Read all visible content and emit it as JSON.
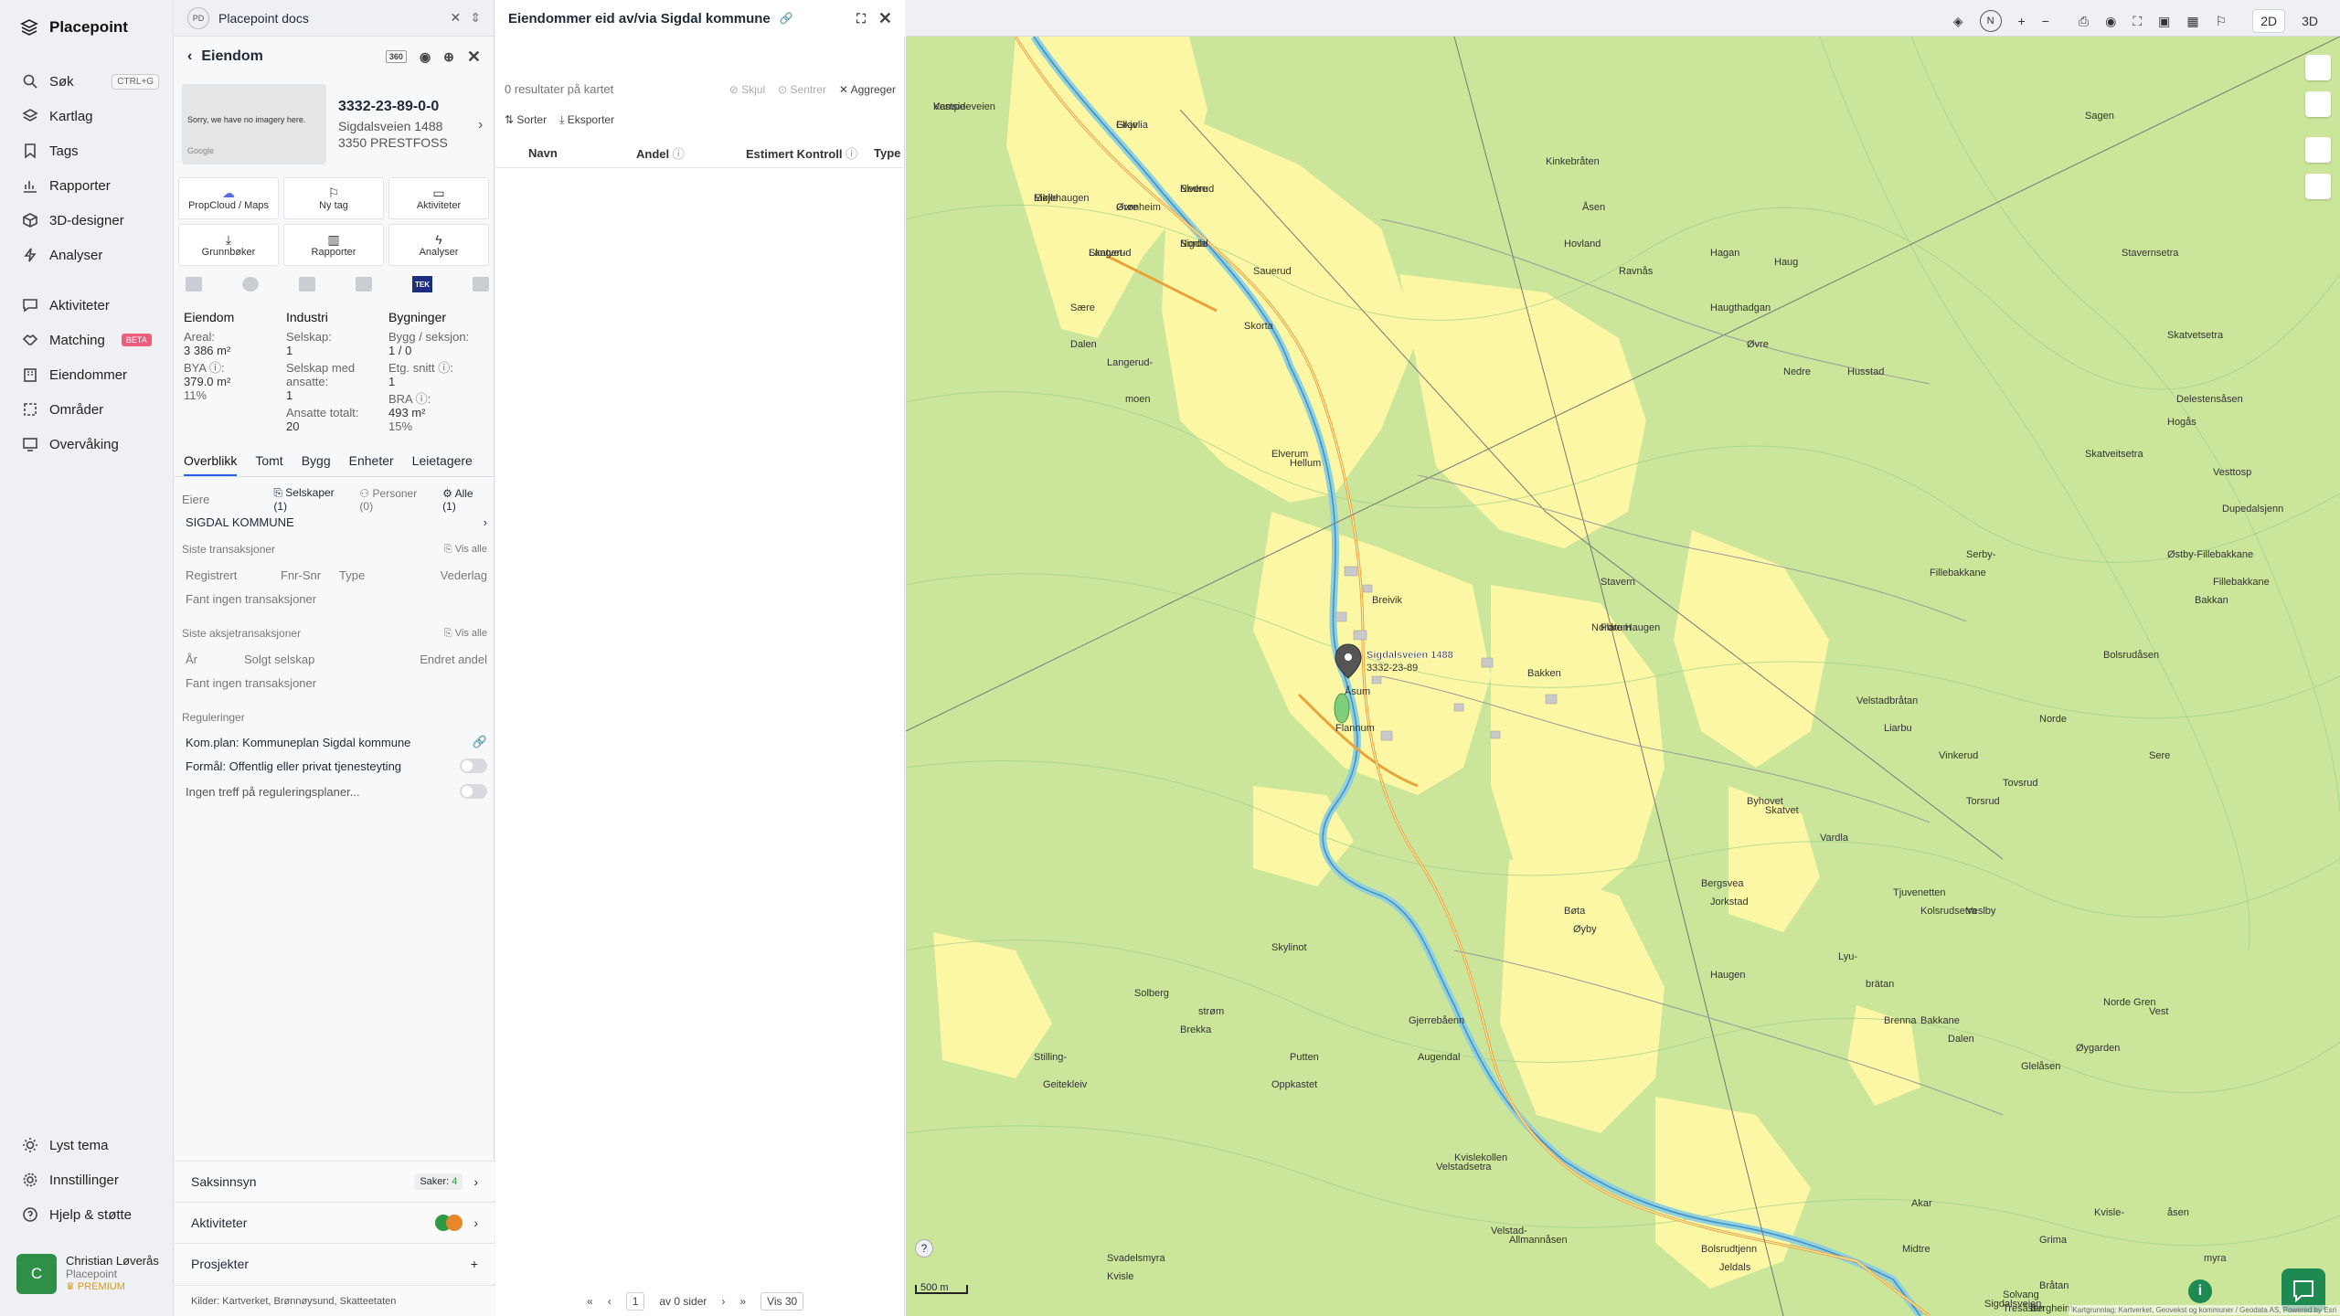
{
  "app": {
    "name": "Placepoint"
  },
  "sidebar": {
    "search": {
      "label": "Søk",
      "shortcut": "CTRL+G"
    },
    "items": [
      {
        "label": "Kartlag"
      },
      {
        "label": "Tags"
      },
      {
        "label": "Rapporter"
      },
      {
        "label": "3D-designer"
      },
      {
        "label": "Analyser"
      },
      {
        "label": "Aktiviteter"
      },
      {
        "label": "Matching",
        "badge": "BETA"
      },
      {
        "label": "Eiendommer"
      },
      {
        "label": "Områder"
      },
      {
        "label": "Overvåking"
      }
    ],
    "bottom": [
      {
        "label": "Lyst tema"
      },
      {
        "label": "Innstillinger"
      },
      {
        "label": "Hjelp & støtte"
      }
    ],
    "user": {
      "initial": "C",
      "name": "Christian Løverås",
      "org": "Placepoint",
      "plan": "PREMIUM"
    }
  },
  "docs": {
    "badge": "PD",
    "title": "Placepoint docs"
  },
  "property": {
    "header": "Eiendom",
    "id_badge": "360",
    "gnr": "3332-23-89-0-0",
    "address": "Sigdalsveien 1488",
    "postal": "3350 PRESTFOSS",
    "image_text": "Sorry, we have no imagery here.",
    "image_brand": "Google",
    "actions": [
      {
        "label": "PropCloud / Maps"
      },
      {
        "label": "Ny tag"
      },
      {
        "label": "Aktiviteter"
      },
      {
        "label": "Grunnbøker"
      },
      {
        "label": "Rapporter"
      },
      {
        "label": "Analyser"
      }
    ],
    "tek_label": "TEK",
    "stats": {
      "eiendom": {
        "h": "Eiendom",
        "areal_l": "Areal:",
        "areal_v": "3 386 m²",
        "bya_l": "BYA ⓘ:",
        "bya_v": "379.0 m²",
        "bya_p": "11%"
      },
      "industri": {
        "h": "Industri",
        "selskap_l": "Selskap:",
        "selskap_v": "1",
        "ansatte_l": "Selskap med ansatte:",
        "ansatte_v": "1",
        "tot_l": "Ansatte totalt:",
        "tot_v": "20"
      },
      "bygninger": {
        "h": "Bygninger",
        "bygg_l": "Bygg / seksjon:",
        "bygg_v": "1 / 0",
        "etg_l": "Etg. snitt ⓘ:",
        "etg_v": "1",
        "bra_l": "BRA ⓘ:",
        "bra_v": "493 m²",
        "bra_p": "15%"
      }
    },
    "tabs": [
      "Overblikk",
      "Tomt",
      "Bygg",
      "Enheter",
      "Leietagere"
    ],
    "owners": {
      "label": "Eiere",
      "f1": "Selskaper (1)",
      "f2": "Personer (0)",
      "f3": "Alle (1)",
      "name": "SIGDAL KOMMUNE"
    },
    "transactions": {
      "title": "Siste transaksjoner",
      "link": "Vis alle",
      "cols": [
        "Registrert",
        "Fnr-Snr",
        "Type",
        "Vederlag"
      ],
      "empty": "Fant ingen transaksjoner"
    },
    "share_tx": {
      "title": "Siste aksjetransaksjoner",
      "link": "Vis alle",
      "cols": [
        "År",
        "Solgt selskap",
        "Endret andel"
      ],
      "empty": "Fant ingen transaksjoner"
    },
    "regs": {
      "title": "Reguleringer",
      "plan": "Kom.plan: Kommuneplan Sigdal kommune",
      "formal": "Formål: Offentlig eller privat tjenesteyting",
      "none": "Ingen treff på reguleringsplaner..."
    },
    "bottom": {
      "saksinnsyn": "Saksinnsyn",
      "saker": "Saker:",
      "saker_n": "4",
      "aktiviteter": "Aktiviteter",
      "prosjekter": "Prosjekter"
    },
    "sources": {
      "label": "Kilder:",
      "list": "Kartverket, Brønnøysund, Skatteetaten"
    }
  },
  "owned": {
    "title": "Eiendommer eid av/via Sigdal kommune",
    "count": "0 resultater på kartet",
    "hide": "Skjul",
    "center": "Sentrer",
    "aggregate": "Aggreger",
    "sort": "Sorter",
    "export": "Eksporter",
    "cols": [
      "Navn",
      "Andel",
      "Estimert Kontroll",
      "Type"
    ],
    "pager": {
      "page": "1",
      "of": "av 0 sider",
      "per": "Vis 30"
    }
  },
  "map": {
    "mode_2d": "2D",
    "mode_3d": "3D",
    "north": "N",
    "scale": "500 m",
    "marker": "Sigdalsveien 1488",
    "marker_sub": "3332-23-89",
    "attribution": "Kartgrunnlag: Kartverket, Geovekst og kommuner / Geodata AS, Powered by Esri",
    "places": [
      "Vestsideveien",
      "Elkje",
      "Eikjehaugen",
      "Grønheim",
      "Elverud",
      "Norde",
      "Langerud",
      "Sære",
      "Dalen",
      "Sauerud",
      "Skorta",
      "Langerud-",
      "moen",
      "Elverum",
      "Hellum",
      "Kinkebråten",
      "Åsen",
      "Hovland",
      "Ravnås",
      "Hagan",
      "Haug",
      "Haugthadgan",
      "Øvre",
      "Nedre",
      "Husstad",
      "Sagen",
      "Stavernsetra",
      "Skatvetsetra",
      "Delestensåsen",
      "Hogås",
      "Skatveitsetra",
      "Vesttosp",
      "Dupedalsjenn",
      "Østby-Fillebakkane",
      "Fillebakkane",
      "Bakkan",
      "Serby-",
      "Fillebakkane",
      "Nordre Haugen",
      "Stavern",
      "Flatum",
      "Bakken",
      "Breivik",
      "Åsum",
      "Flannum",
      "Bolsrudåsen",
      "Velstadbråtan",
      "Liarbu",
      "Vinkerud",
      "Norde",
      "Sere",
      "Tovsrud",
      "Torsrud",
      "Byhovet",
      "Skatvet",
      "Vardla",
      "Jorkstad",
      "Bergsvea",
      "Tjuvenetten",
      "Kolsrudsetra",
      "Veslby",
      "Bøta",
      "Øyby",
      "Haugen",
      "Lyu-",
      "brätan",
      "Brenna",
      "Bakkane",
      "Dalen",
      "Glelåsen",
      "Øygarden",
      "Norde Gren",
      "Vest",
      "strøm",
      "Skylinot",
      "Solberg",
      "Brekka",
      "Putten",
      "Oppkastet",
      "Gjerrebåenn",
      "Augendal",
      "Stilling-",
      "Geitekleiv",
      "Svadelsmyra",
      "Kvisle",
      "Kvislekollen",
      "Velstadsetra",
      "Velstad-",
      "Allmannåsen",
      "Bolsrudtjenn",
      "Jeldals",
      "myra",
      "Kvisle-",
      "åsen",
      "Akar",
      "Midtre",
      "Grima",
      "Bråtan",
      "Solvang",
      "Sigdalsveien",
      "Tresåsen",
      "Bergheim",
      "Kampe-",
      "Gravlia",
      "Mølle",
      "Øvre",
      "Nedre",
      "Sigdal",
      "Skatvet-"
    ]
  }
}
